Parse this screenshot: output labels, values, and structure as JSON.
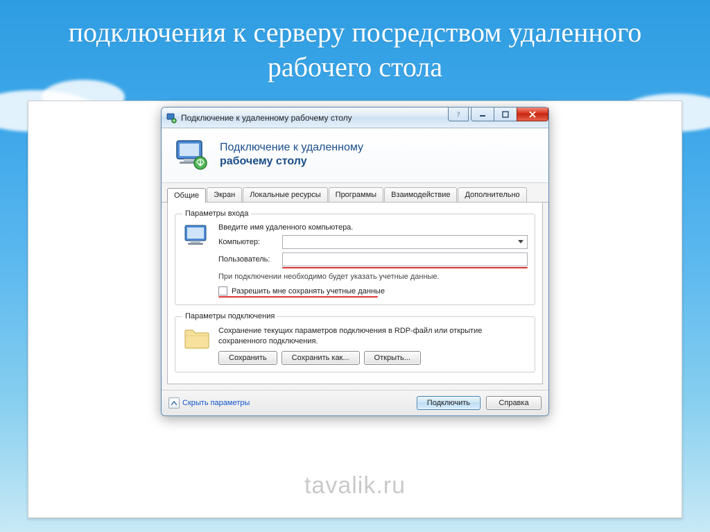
{
  "slide": {
    "title": "подключения к серверу посредством удаленного рабочего стола"
  },
  "watermark": "tavalik.ru",
  "window": {
    "title": "Подключение к удаленному рабочему столу",
    "banner_line1": "Подключение к удаленному",
    "banner_line2": "рабочему столу"
  },
  "tabs": [
    {
      "label": "Общие",
      "active": true
    },
    {
      "label": "Экран",
      "active": false
    },
    {
      "label": "Локальные ресурсы",
      "active": false
    },
    {
      "label": "Программы",
      "active": false
    },
    {
      "label": "Взаимодействие",
      "active": false
    },
    {
      "label": "Дополнительно",
      "active": false
    }
  ],
  "login": {
    "legend": "Параметры входа",
    "instruction": "Введите имя удаленного компьютера.",
    "computer_label": "Компьютер:",
    "computer_value": "",
    "user_label": "Пользователь:",
    "user_value": "",
    "note": "При подключении необходимо будет указать учетные данные.",
    "save_creds_label": "Разрешить мне сохранять учетные данные"
  },
  "connection": {
    "legend": "Параметры подключения",
    "note": "Сохранение текущих параметров подключения в RDP-файл или открытие сохраненного подключения.",
    "save": "Сохранить",
    "save_as": "Сохранить как...",
    "open": "Открыть..."
  },
  "footer": {
    "hide_params": "Скрыть параметры",
    "connect": "Подключить",
    "help": "Справка"
  }
}
